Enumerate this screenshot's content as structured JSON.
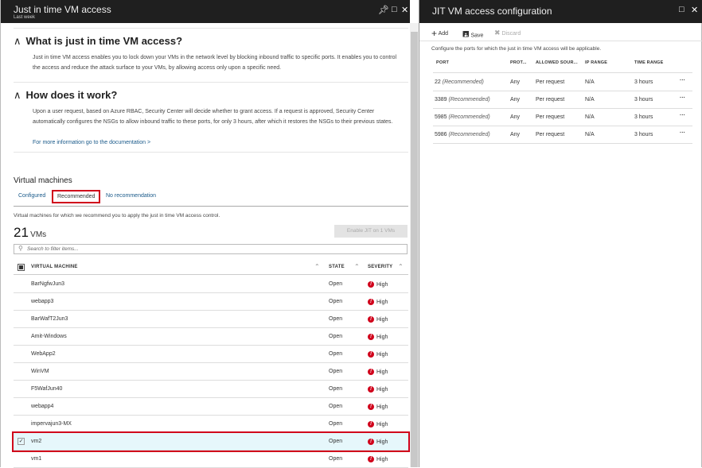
{
  "left": {
    "title": "Just in time VM access",
    "subtitle": "Last week",
    "what": {
      "heading": "What is just in time VM access?",
      "body": "Just in time VM access enables you to lock down your VMs in the network level by blocking inbound traffic to specific ports. It enables you to control the access and reduce the attack surface to your VMs, by allowing access only upon a specific need."
    },
    "how": {
      "heading": "How does it work?",
      "body": "Upon a user request, based on Azure RBAC, Security Center will decide whether to grant access. If a request is approved, Security Center automatically configures the NSGs to allow inbound traffic to these ports, for only 3 hours, after which it restores the NSGs to their previous states.",
      "link": "For more information go to the documentation >"
    },
    "vm_section": "Virtual machines",
    "tabs": [
      "Configured",
      "Recommended",
      "No recommendation"
    ],
    "tab_desc": "Virtual machines for which we recommend you to apply the just in time VM access control.",
    "count": "21",
    "count_unit": "VMs",
    "enable_button": "Enable JIT on 1 VMs",
    "search_placeholder": "Search to filter items...",
    "columns": [
      "VIRTUAL MACHINE",
      "STATE",
      "SEVERITY"
    ],
    "rows": [
      {
        "name": "BarNgfwJun3",
        "state": "Open",
        "severity": "High"
      },
      {
        "name": "webapp3",
        "state": "Open",
        "severity": "High"
      },
      {
        "name": "BarWafT2Jun3",
        "state": "Open",
        "severity": "High"
      },
      {
        "name": "Amit-Windows",
        "state": "Open",
        "severity": "High"
      },
      {
        "name": "WebApp2",
        "state": "Open",
        "severity": "High"
      },
      {
        "name": "WinVM",
        "state": "Open",
        "severity": "High"
      },
      {
        "name": "F5WafJun40",
        "state": "Open",
        "severity": "High"
      },
      {
        "name": "webapp4",
        "state": "Open",
        "severity": "High"
      },
      {
        "name": "impervajun3-MX",
        "state": "Open",
        "severity": "High"
      },
      {
        "name": "vm2",
        "state": "Open",
        "severity": "High",
        "selected": true
      },
      {
        "name": "vm1",
        "state": "Open",
        "severity": "High"
      }
    ]
  },
  "right": {
    "title": "JIT VM access configuration",
    "toolbar": {
      "add": "Add",
      "save": "Save",
      "discard": "Discard"
    },
    "desc": "Configure the ports for which the just in time VM access will be applicable.",
    "columns": [
      "PORT",
      "PROT...",
      "ALLOWED SOUR...",
      "IP RANGE",
      "TIME RANGE"
    ],
    "rows": [
      {
        "port": "22",
        "tag": "(Recommended)",
        "protocol": "Any",
        "source": "Per request",
        "ip": "N/A",
        "time": "3 hours"
      },
      {
        "port": "3389",
        "tag": "(Recommended)",
        "protocol": "Any",
        "source": "Per request",
        "ip": "N/A",
        "time": "3 hours"
      },
      {
        "port": "5985",
        "tag": "(Recommended)",
        "protocol": "Any",
        "source": "Per request",
        "ip": "N/A",
        "time": "3 hours"
      },
      {
        "port": "5986",
        "tag": "(Recommended)",
        "protocol": "Any",
        "source": "Per request",
        "ip": "N/A",
        "time": "3 hours"
      }
    ]
  },
  "colors": {
    "header": "#1f1f1f",
    "highlight": "#d0021b",
    "selected_row": "#e6f7fb",
    "link": "#1a5a8a"
  }
}
